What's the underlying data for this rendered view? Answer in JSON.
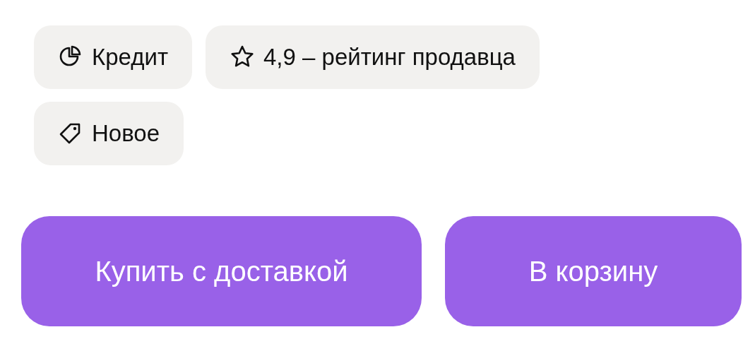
{
  "tags": [
    {
      "label": "Кредит"
    },
    {
      "label": "4,9 – рейтинг продавца"
    },
    {
      "label": "Новое"
    }
  ],
  "buttons": [
    {
      "label": "Купить с доставкой"
    },
    {
      "label": "В корзину"
    }
  ]
}
